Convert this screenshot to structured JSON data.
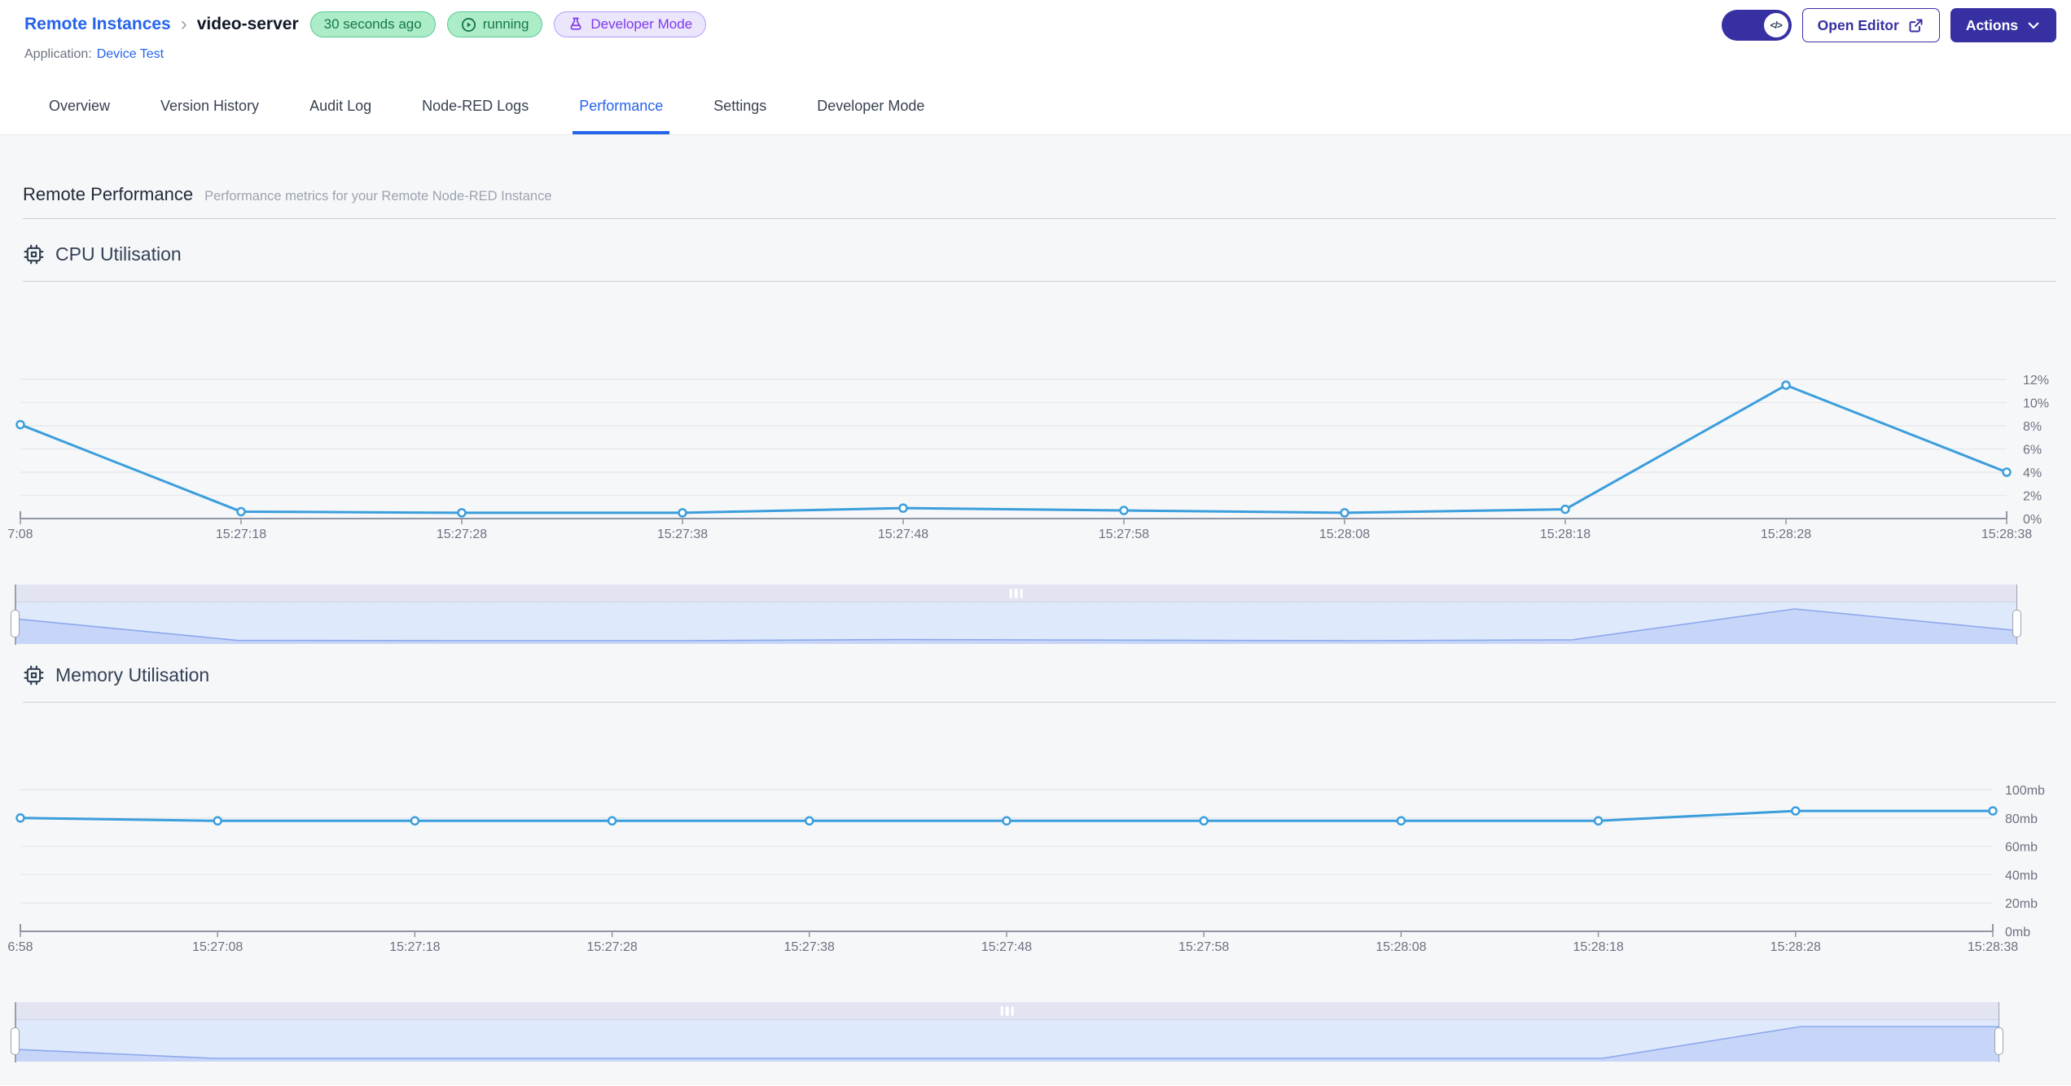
{
  "header": {
    "breadcrumb": {
      "parent": "Remote Instances",
      "current": "video-server"
    },
    "badges": {
      "last_seen": "30 seconds ago",
      "status": "running",
      "mode": "Developer Mode"
    },
    "application_label": "Application:",
    "application_name": "Device Test",
    "actions": {
      "open_editor": "Open Editor",
      "actions_menu": "Actions"
    },
    "toggle_icon": "</>"
  },
  "tabs": [
    {
      "label": "Overview",
      "active": false
    },
    {
      "label": "Version History",
      "active": false
    },
    {
      "label": "Audit Log",
      "active": false
    },
    {
      "label": "Node-RED Logs",
      "active": false
    },
    {
      "label": "Performance",
      "active": true
    },
    {
      "label": "Settings",
      "active": false
    },
    {
      "label": "Developer Mode",
      "active": false
    }
  ],
  "page": {
    "title": "Remote Performance",
    "subtitle": "Performance metrics for your Remote Node-RED Instance"
  },
  "chart_data": [
    {
      "id": "cpu",
      "type": "line",
      "title": "CPU Utilisation",
      "categories": [
        "7:08",
        "15:27:18",
        "15:27:28",
        "15:27:38",
        "15:27:48",
        "15:27:58",
        "15:28:08",
        "15:28:18",
        "15:28:28",
        "15:28:38"
      ],
      "values": [
        8.1,
        0.6,
        0.5,
        0.5,
        0.9,
        0.7,
        0.5,
        0.8,
        11.5,
        4
      ],
      "ytick_labels": [
        "0%",
        "2%",
        "4%",
        "6%",
        "8%",
        "10%",
        "12%"
      ],
      "ylim": [
        0,
        12
      ],
      "ylabel_side": "right",
      "grid": true,
      "legend": "none",
      "line_color": "#3b9edc",
      "has_range_brush": true
    },
    {
      "id": "memory",
      "type": "line",
      "title": "Memory Utilisation",
      "categories": [
        "6:58",
        "15:27:08",
        "15:27:18",
        "15:27:28",
        "15:27:38",
        "15:27:48",
        "15:27:58",
        "15:28:08",
        "15:28:18",
        "15:28:28",
        "15:28:38"
      ],
      "values": [
        80,
        78,
        78,
        78,
        78,
        78,
        78,
        78,
        78,
        85,
        85
      ],
      "ytick_labels": [
        "0mb",
        "20mb",
        "40mb",
        "60mb",
        "80mb",
        "100mb"
      ],
      "ylim": [
        0,
        100
      ],
      "ylabel_side": "right",
      "grid": true,
      "legend": "none",
      "line_color": "#3b9edc",
      "has_range_brush": true
    }
  ],
  "colors": {
    "brand_indigo": "#3730a3",
    "link_blue": "#2563eb",
    "active_tab_blue": "#2563eb",
    "badge_green_bg": "#acecc6",
    "badge_green_border": "#55cb96",
    "badge_green_text": "#17774f",
    "badge_violet_bg": "#ece6fd",
    "badge_violet_border": "#b79df8",
    "badge_violet_text": "#7c3aed",
    "chart_line_blue": "#3b9edc",
    "brush_fill": "#c7d6f8",
    "brush_line": "#8ca8ec"
  }
}
